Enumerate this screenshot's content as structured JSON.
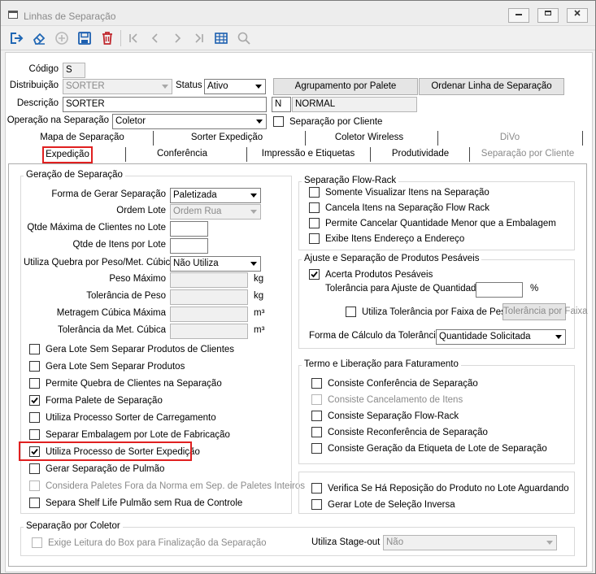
{
  "window": {
    "title": "Linhas de Separação",
    "min": "▭",
    "max": "□",
    "close": "✕"
  },
  "toolbar": {
    "icons": [
      "exit-icon",
      "eraser-icon",
      "add-icon",
      "save-icon",
      "delete-icon",
      "first-icon",
      "previous-icon",
      "next-icon",
      "last-icon",
      "grid-icon",
      "search-icon"
    ]
  },
  "form": {
    "codigo_label": "Código",
    "codigo_value": "S",
    "distribuicao_label": "Distribuição",
    "distribuicao_value": "SORTER",
    "status_label": "Status",
    "status_value": "Ativo",
    "agrupamento_button": "Agrupamento por Palete",
    "ordenar_button": "Ordenar Linha de Separação",
    "descricao_label": "Descrição",
    "descricao_value": "SORTER",
    "tipo_code": "N",
    "tipo_desc": "NORMAL",
    "operacao_label": "Operação na Separação",
    "operacao_value": "Coletor",
    "sep_cliente_label": "Separação por Cliente"
  },
  "tabs_row1": [
    "Mapa de Separação",
    "Sorter Expedição",
    "Coletor Wireless",
    "DiVo"
  ],
  "tabs_row2": [
    "Expedição",
    "Conferência",
    "Impressão e Etiquetas",
    "Produtividade",
    "Separação por Cliente"
  ],
  "geracao": {
    "title": "Geração de Separação",
    "forma_label": "Forma de Gerar Separação",
    "forma_value": "Paletizada",
    "ordem_label": "Ordem Lote",
    "ordem_value": "Ordem Rua",
    "qtde_clientes_label": "Qtde Máxima de Clientes no Lote",
    "qtde_itens_label": "Qtde de Itens por Lote",
    "quebra_label": "Utiliza Quebra por Peso/Met. Cúbica",
    "quebra_value": "Não Utiliza",
    "peso_label": "Peso Máximo",
    "peso_unit": "kg",
    "tol_peso_label": "Tolerância de Peso",
    "tol_peso_unit": "kg",
    "metragem_label": "Metragem Cúbica Máxima",
    "metragem_unit": "m³",
    "tol_met_label": "Tolerância da Met. Cúbica",
    "tol_met_unit": "m³",
    "checks": [
      {
        "label": "Gera Lote Sem Separar Produtos de Clientes",
        "checked": false,
        "disabled": false
      },
      {
        "label": "Gera Lote Sem Separar Produtos",
        "checked": false,
        "disabled": false
      },
      {
        "label": "Permite Quebra de Clientes na Separação",
        "checked": false,
        "disabled": false
      },
      {
        "label": "Forma Palete de Separação",
        "checked": true,
        "disabled": false
      },
      {
        "label": "Utiliza Processo Sorter de Carregamento",
        "checked": false,
        "disabled": false
      },
      {
        "label": "Separar Embalagem por Lote de Fabricação",
        "checked": false,
        "disabled": false
      },
      {
        "label": "Utiliza Processo de Sorter Expedição",
        "checked": true,
        "disabled": false
      },
      {
        "label": "Gerar Separação de Pulmão",
        "checked": false,
        "disabled": false
      },
      {
        "label": "Considera Paletes Fora da Norma em Sep. de Paletes Inteiros",
        "checked": false,
        "disabled": true
      },
      {
        "label": "Separa Shelf Life Pulmão sem Rua de Controle",
        "checked": false,
        "disabled": false
      }
    ]
  },
  "flowrack": {
    "title": "Separação Flow-Rack",
    "checks": [
      {
        "label": "Somente Visualizar Itens na Separação",
        "checked": false,
        "disabled": false
      },
      {
        "label": "Cancela Itens na Separação Flow Rack",
        "checked": false,
        "disabled": false
      },
      {
        "label": "Permite Cancelar Quantidade Menor que a Embalagem",
        "checked": false,
        "disabled": false
      },
      {
        "label": "Exibe Itens Endereço a Endereço",
        "checked": false,
        "disabled": false
      }
    ]
  },
  "pesaveis": {
    "title": "Ajuste e Separação de Produtos Pesáveis",
    "acerta_label": "Acerta Produtos Pesáveis",
    "acerta_checked": true,
    "tol_ajuste_label": "Tolerância para Ajuste de Quantidade",
    "tol_ajuste_unit": "%",
    "faixa_label": "Utiliza Tolerância por Faixa de Peso",
    "faixa_button": "Tolerância por Faixa",
    "calculo_label": "Forma de Cálculo da Tolerância",
    "calculo_value": "Quantidade Solicitada"
  },
  "termo": {
    "title": "Termo e Liberação para Faturamento",
    "checks": [
      {
        "label": "Consiste Conferência de Separação",
        "checked": false,
        "disabled": false
      },
      {
        "label": "Consiste Cancelamento de Itens",
        "checked": false,
        "disabled": true
      },
      {
        "label": "Consiste Separação Flow-Rack",
        "checked": false,
        "disabled": false
      },
      {
        "label": "Consiste Reconferência de Separação",
        "checked": false,
        "disabled": false
      },
      {
        "label": "Consiste Geração da Etiqueta de Lote de Separação",
        "checked": false,
        "disabled": false
      }
    ]
  },
  "misc": {
    "checks": [
      {
        "label": "Verifica Se Há Reposição do Produto no Lote Aguardando",
        "checked": false,
        "disabled": false
      },
      {
        "label": "Gerar Lote de Seleção Inversa",
        "checked": false,
        "disabled": false
      }
    ]
  },
  "coletor": {
    "title": "Separação por Coletor",
    "exige_label": "Exige Leitura do Box para Finalização da Separação",
    "stage_label": "Utiliza Stage-out",
    "stage_value": "Não"
  },
  "colors": {
    "highlight": "#e02020",
    "save_blue": "#1c5fb0",
    "delete_red": "#c0262c",
    "exit_blue": "#2067b4"
  }
}
